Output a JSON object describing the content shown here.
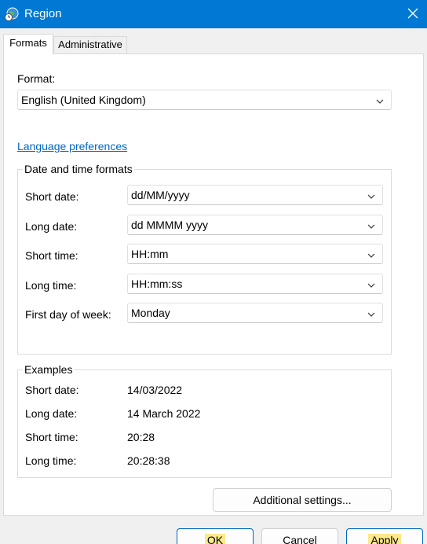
{
  "window": {
    "title": "Region"
  },
  "tabs": [
    {
      "label": "Formats",
      "active": true
    },
    {
      "label": "Administrative",
      "active": false
    }
  ],
  "format": {
    "label": "Format:",
    "value": "English (United Kingdom)"
  },
  "language_link": "Language preferences",
  "date_time_formats": {
    "title": "Date and time formats",
    "short_date": {
      "label": "Short date:",
      "value": "dd/MM/yyyy"
    },
    "long_date": {
      "label": "Long date:",
      "value": "dd MMMM yyyy"
    },
    "short_time": {
      "label": "Short time:",
      "value": "HH:mm"
    },
    "long_time": {
      "label": "Long time:",
      "value": "HH:mm:ss"
    },
    "first_day": {
      "label": "First day of week:",
      "value": "Monday"
    }
  },
  "examples": {
    "title": "Examples",
    "short_date": {
      "label": "Short date:",
      "value": "14/03/2022"
    },
    "long_date": {
      "label": "Long date:",
      "value": "14 March 2022"
    },
    "short_time": {
      "label": "Short time:",
      "value": "20:28"
    },
    "long_time": {
      "label": "Long time:",
      "value": "20:28:38"
    }
  },
  "buttons": {
    "additional": "Additional settings...",
    "ok": "OK",
    "cancel": "Cancel",
    "apply": "Apply"
  },
  "colors": {
    "titlebar": "#0078d4",
    "link": "#0067c0",
    "highlight": "#fbe98a"
  },
  "icons": {
    "app": "globe-clock-icon",
    "close": "close-icon",
    "dropdown": "chevron-down-icon"
  }
}
